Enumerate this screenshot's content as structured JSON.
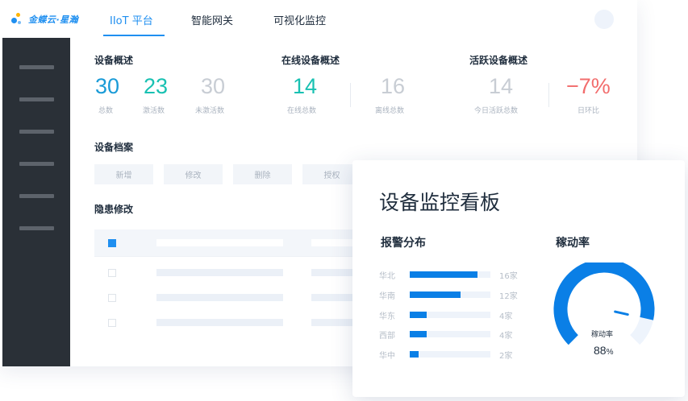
{
  "brand": {
    "name": "金蝶云·星瀚"
  },
  "nav": {
    "tabs": [
      {
        "label": "IIoT 平台",
        "active": true
      },
      {
        "label": "智能网关",
        "active": false
      },
      {
        "label": "可视化监控",
        "active": false
      }
    ]
  },
  "sidebar": {
    "item_count": 6
  },
  "overview": {
    "device": {
      "title": "设备概述",
      "stats": [
        {
          "value": "30",
          "label": "总数",
          "color": "#1a9bd7"
        },
        {
          "value": "23",
          "label": "激活数",
          "color": "#19c1b2"
        },
        {
          "value": "30",
          "label": "未激活数",
          "color": "#c8cdd4"
        }
      ]
    },
    "online": {
      "title": "在线设备概述",
      "stats": [
        {
          "value": "14",
          "label": "在线总数",
          "color": "#19c1b2"
        },
        {
          "value": "16",
          "label": "离线总数",
          "color": "#c8cdd4"
        }
      ]
    },
    "active": {
      "title": "活跃设备概述",
      "stats": [
        {
          "value": "14",
          "label": "今日活跃总数",
          "color": "#c8cdd4"
        },
        {
          "value": "−7%",
          "label": "日环比",
          "color": "#f26d6d"
        }
      ]
    }
  },
  "archive": {
    "title": "设备档案",
    "buttons": [
      "新增",
      "修改",
      "删除",
      "授权"
    ]
  },
  "hazard": {
    "title": "隐患修改"
  },
  "dashboard": {
    "title": "设备监控看板",
    "alarm": {
      "title": "报警分布",
      "rows": [
        {
          "region": "华北",
          "count": 16,
          "label": "16家"
        },
        {
          "region": "华南",
          "count": 12,
          "label": "12家"
        },
        {
          "region": "华东",
          "count": 4,
          "label": "4家"
        },
        {
          "region": "西部",
          "count": 4,
          "label": "4家"
        },
        {
          "region": "华中",
          "count": 2,
          "label": "2家"
        }
      ],
      "max": 19
    },
    "mobility": {
      "title": "稼动率",
      "gauge_label": "稼动率",
      "value": "88",
      "unit": "%",
      "fraction": 0.88,
      "colors": {
        "fill": "#0a7fe6",
        "track": "#eef4fc"
      }
    }
  }
}
